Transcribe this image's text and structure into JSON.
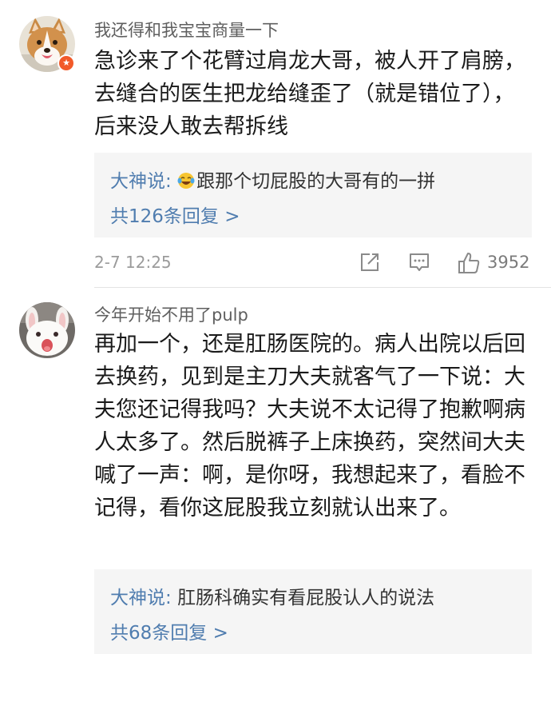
{
  "comments": [
    {
      "username": "我还得和我宝宝商量一下",
      "avatar": "corgi-avatar",
      "verified_badge": "vip-badge-icon",
      "text": "急诊来了个花臂过肩龙大哥，被人开了肩膀，去缝合的医生把龙给缝歪了（就是错位了），后来没人敢去帮拆线",
      "top_reply": {
        "author": "大神说",
        "separator": ":",
        "emoji": "laughing-tears-emoji",
        "text": "跟那个切屁股的大哥有的一拼"
      },
      "reply_count_label": "共126条回复 >",
      "timestamp": "2-7 12:25",
      "actions": {
        "share_icon": "share-icon",
        "comment_icon": "comment-icon",
        "like_icon": "thumbs-up-icon",
        "like_count": "3952"
      }
    },
    {
      "username": "今年开始不用了pulp",
      "avatar": "rabbit-avatar",
      "text": "再加一个，还是肛肠医院的。病人出院以后回去换药，见到是主刀大夫就客气了一下说：大夫您还记得我吗？大夫说不太记得了抱歉啊病人太多了。然后脱裤子上床换药，突然间大夫喊了一声：啊，是你呀，我想起来了，看脸不记得，看你这屁股我立刻就认出来了。",
      "top_reply": {
        "author": "大神说",
        "separator": ":",
        "text": "肛肠科确实有看屁股认人的说法"
      },
      "reply_count_label": "共68条回复 >"
    }
  ],
  "colors": {
    "link_blue": "#507daf",
    "reply_bg": "#f5f5f5",
    "meta_gray": "#9b9b9b",
    "badge_orange": "#f25a29"
  }
}
